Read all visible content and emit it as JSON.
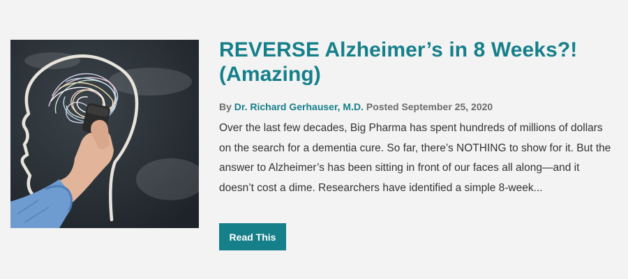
{
  "article": {
    "title": "REVERSE Alzheimer’s in 8 Weeks?! (Amazing)",
    "by_label": "By",
    "author": "Dr. Richard Gerhauser, M.D.",
    "posted_label": "Posted",
    "date": "September 25, 2020",
    "excerpt": "Over the last few decades, Big Pharma has spent hundreds of millions of dollars on the search for a dementia cure. So far, there’s NOTHING to show for it. But the answer to Alzheimer’s has been sitting in front of our faces all along—and it doesn’t cost a dime. Researchers have identified a simple 8-week...",
    "button_label": "Read This",
    "image_icon": "chalkboard-head-eraser-image"
  },
  "colors": {
    "accent": "#157f8a",
    "background": "#f3f3f3",
    "text": "#333333",
    "meta": "#6c6c6c"
  }
}
